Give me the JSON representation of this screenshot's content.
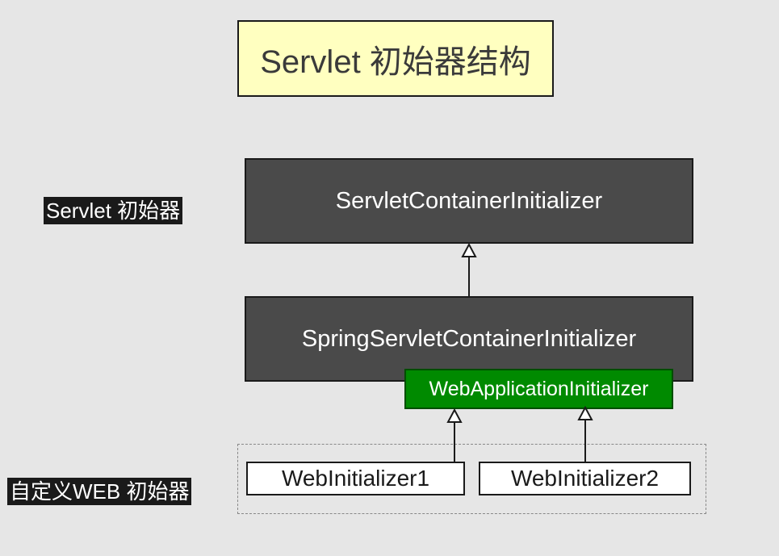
{
  "title": "Servlet 初始器结构",
  "labels": {
    "servlet_initializer": "Servlet 初始器",
    "custom_web_initializer": "自定义WEB 初始器"
  },
  "nodes": {
    "servlet_container_initializer": "ServletContainerInitializer",
    "spring_servlet_container_initializer": "SpringServletContainerInitializer",
    "web_application_initializer": "WebApplicationInitializer",
    "web_initializer_1": "WebInitializer1",
    "web_initializer_2": "WebInitializer2"
  },
  "edges": [
    {
      "from": "spring_servlet_container_initializer",
      "to": "servlet_container_initializer",
      "type": "inheritance"
    },
    {
      "from": "web_initializer_1",
      "to": "web_application_initializer",
      "type": "inheritance"
    },
    {
      "from": "web_initializer_2",
      "to": "web_application_initializer",
      "type": "inheritance"
    }
  ],
  "colors": {
    "background": "#e6e6e6",
    "title_fill": "#ffffc0",
    "dark_node": "#4a4a4a",
    "green_node": "#008a00",
    "label_bg": "#1a1a1a"
  }
}
